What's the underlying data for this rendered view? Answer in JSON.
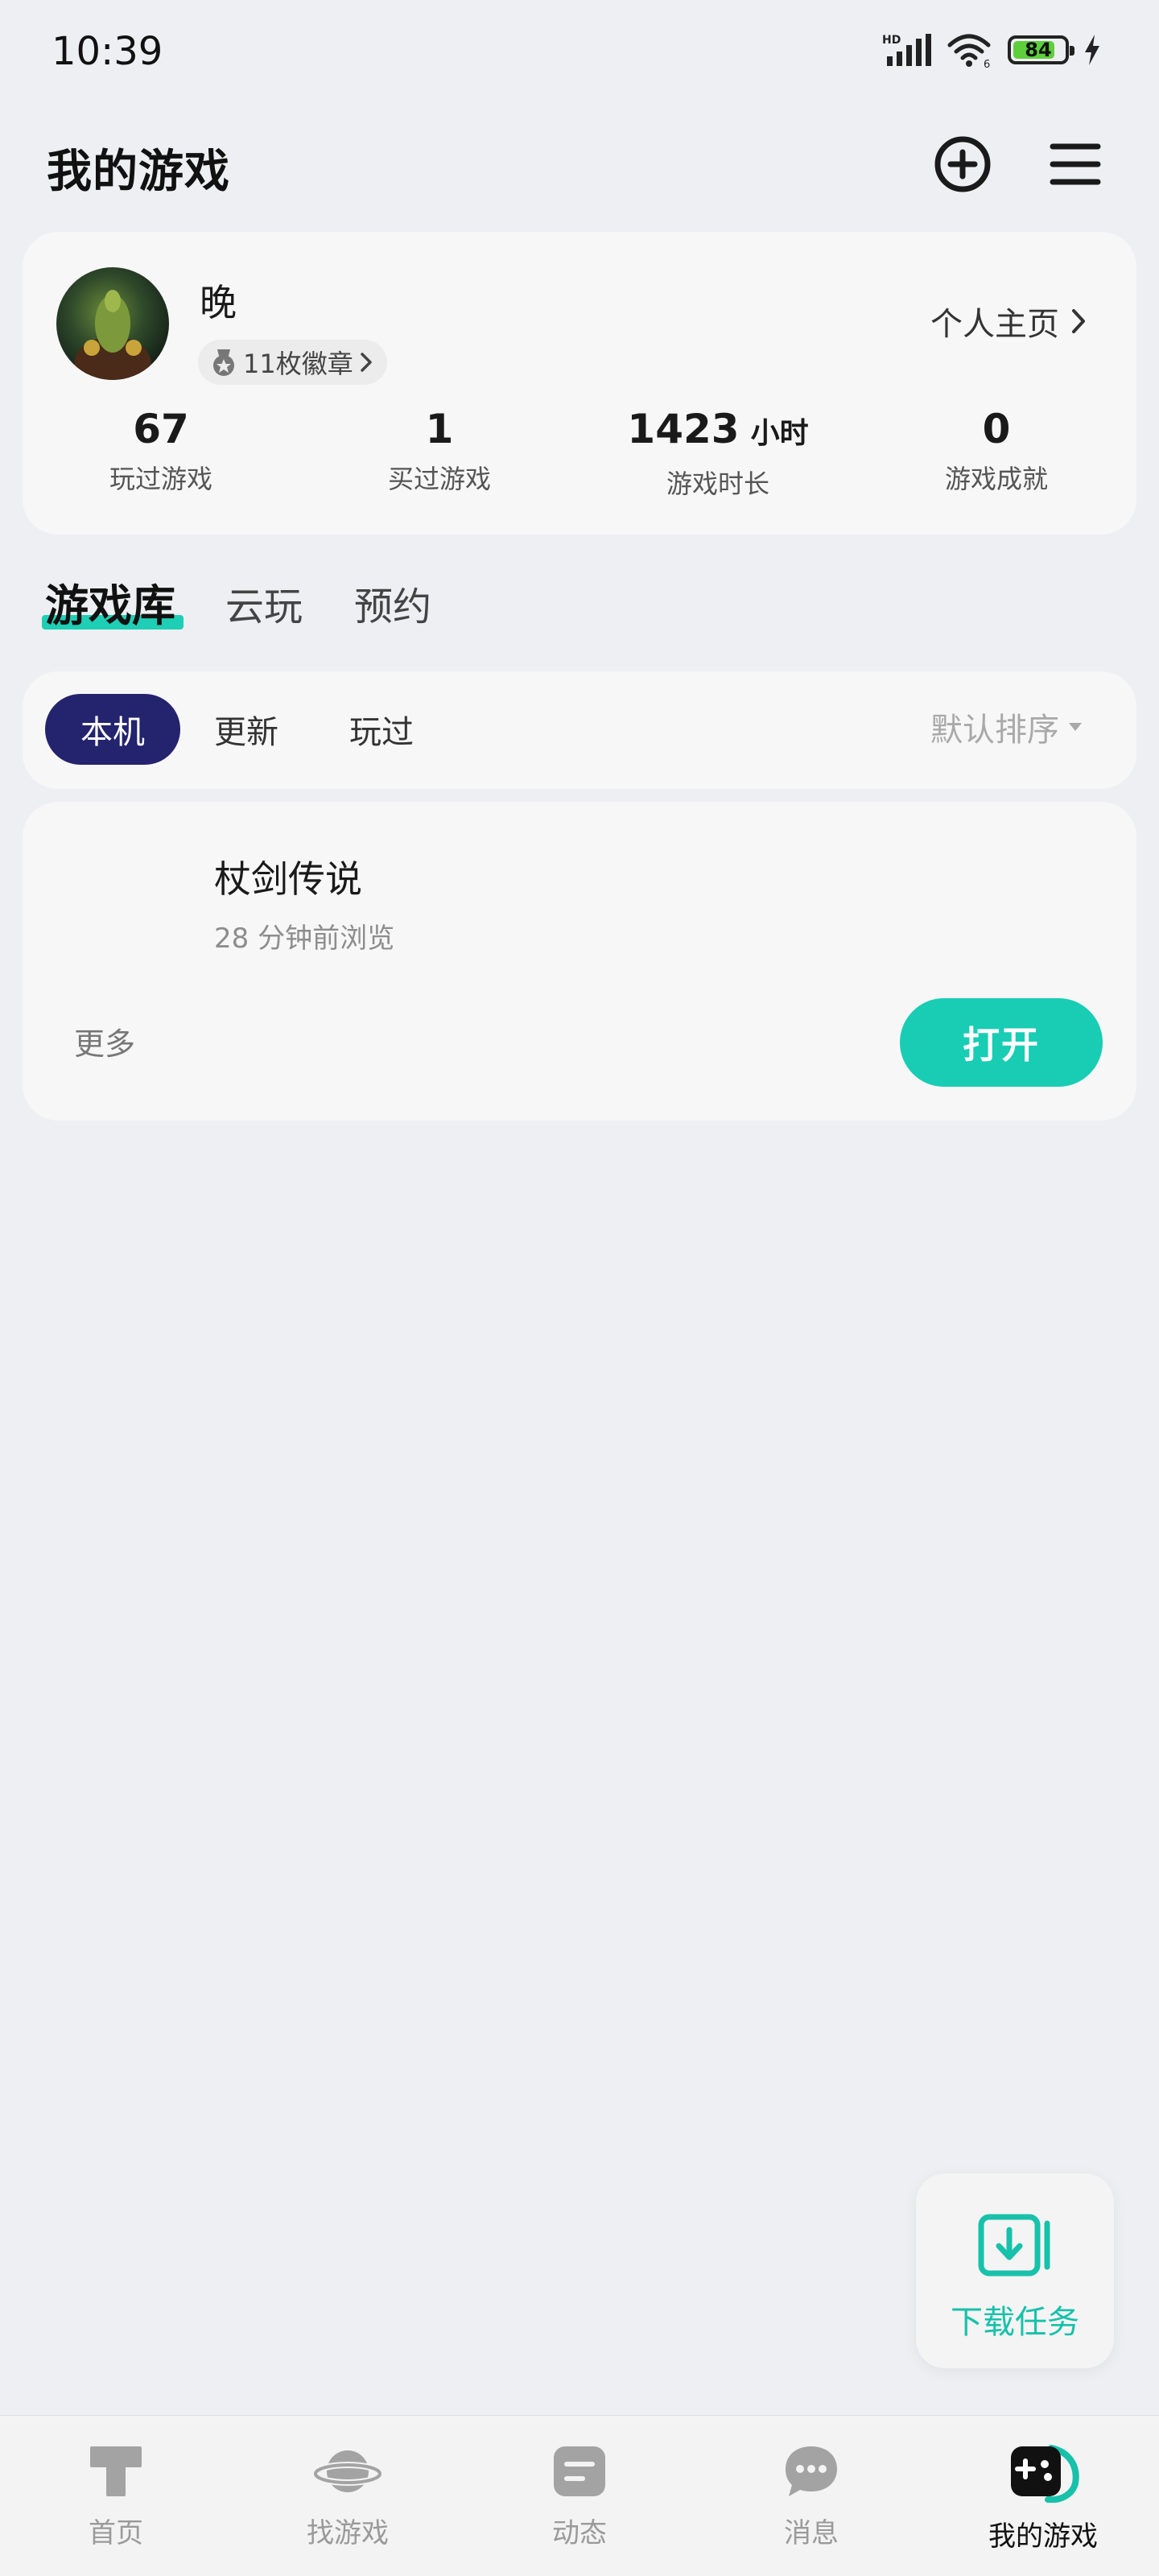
{
  "status_bar": {
    "time": "10:39",
    "battery": "84",
    "battery_level_percent": 84,
    "network": "HD"
  },
  "header": {
    "title": "我的游戏",
    "add_icon": "plus-circle-icon",
    "menu_icon": "hamburger-menu-icon"
  },
  "profile": {
    "username": "晚",
    "badge_text": "11枚徽章",
    "home_link": "个人主页",
    "stats": [
      {
        "value": "67",
        "unit": "",
        "label": "玩过游戏"
      },
      {
        "value": "1",
        "unit": "",
        "label": "买过游戏"
      },
      {
        "value": "1423",
        "unit": "小时",
        "label": "游戏时长"
      },
      {
        "value": "0",
        "unit": "",
        "label": "游戏成就"
      }
    ]
  },
  "tabs": [
    "游戏库",
    "云玩",
    "预约"
  ],
  "filters": {
    "chips": [
      "本机",
      "更新",
      "玩过"
    ],
    "sort": "默认排序"
  },
  "game": {
    "name": "杖剑传说",
    "last_viewed": "28 分钟前浏览",
    "more": "更多",
    "open_button": "打开"
  },
  "download_task": {
    "label": "下载任务"
  },
  "bottom_nav": [
    {
      "label": "首页",
      "icon": "home-t-icon"
    },
    {
      "label": "找游戏",
      "icon": "planet-icon"
    },
    {
      "label": "动态",
      "icon": "feed-icon"
    },
    {
      "label": "消息",
      "icon": "chat-bubble-icon"
    },
    {
      "label": "我的游戏",
      "icon": "gamepad-icon"
    }
  ],
  "colors": {
    "accent": "#18cdb4",
    "chip_active": "#24236e",
    "background": "#eeeff2"
  }
}
